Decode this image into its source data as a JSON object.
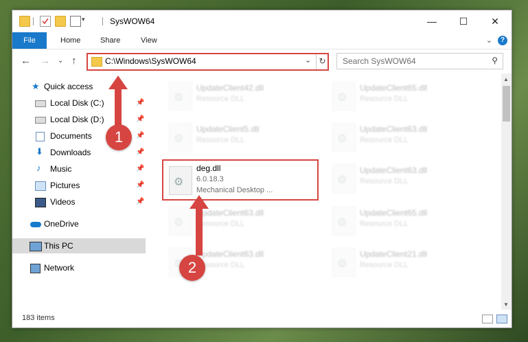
{
  "window": {
    "title": "SysWOW64"
  },
  "ribbon": {
    "tabs": [
      "File",
      "Home",
      "Share",
      "View"
    ],
    "help": "?"
  },
  "address": {
    "path": "C:\\Windows\\SysWOW64"
  },
  "search": {
    "placeholder": "Search SysWOW64"
  },
  "nav": {
    "quick_access": "Quick access",
    "items": [
      {
        "label": "Local Disk (C:)",
        "icon": "drive-icon",
        "pinned": true
      },
      {
        "label": "Local Disk (D:)",
        "icon": "drive-icon",
        "pinned": true
      },
      {
        "label": "Documents",
        "icon": "documents-icon",
        "pinned": true
      },
      {
        "label": "Downloads",
        "icon": "downloads-icon",
        "pinned": true
      },
      {
        "label": "Music",
        "icon": "music-icon",
        "pinned": true
      },
      {
        "label": "Pictures",
        "icon": "pictures-icon",
        "pinned": true
      },
      {
        "label": "Videos",
        "icon": "videos-icon",
        "pinned": true
      }
    ],
    "onedrive": "OneDrive",
    "thispc": "This PC",
    "network": "Network"
  },
  "files": {
    "col1": [
      {
        "name": "UpdateClient42.dll",
        "desc": "Resource DLL"
      },
      {
        "name": "UpdateClient5.dll",
        "desc": "Resource DLL"
      },
      {
        "name": "deg.dll",
        "version": "6.0.18.3",
        "desc": "Mechanical Desktop ..."
      },
      {
        "name": "UpdateClient63.dll",
        "desc": "Resource DLL"
      },
      {
        "name": "UpdateClient63.dll",
        "desc": "Resource DLL"
      }
    ],
    "col2": [
      {
        "name": "UpdateClient65.dll",
        "desc": "Resource DLL"
      },
      {
        "name": "UpdateClient63.dll",
        "desc": "Resource DLL"
      },
      {
        "name": "UpdateClient63.dll",
        "desc": "Resource DLL"
      },
      {
        "name": "UpdateClient65.dll",
        "desc": "Resource DLL"
      },
      {
        "name": "UpdateClient21.dll",
        "desc": "Resource DLL"
      }
    ]
  },
  "status": {
    "count": "183 items"
  },
  "annotations": {
    "step1": "1",
    "step2": "2",
    "color": "#d64541"
  }
}
